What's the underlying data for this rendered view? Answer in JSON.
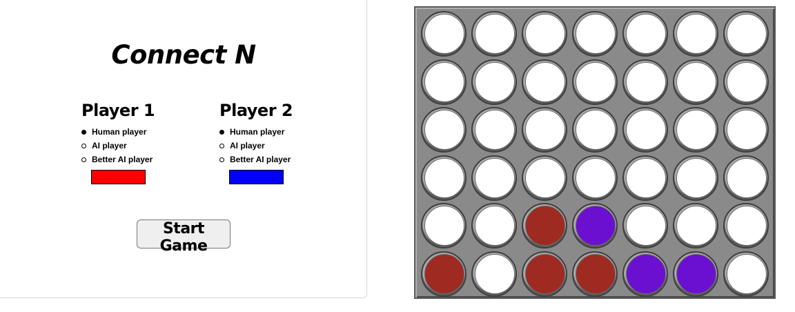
{
  "settings_panel": {
    "title": "Connect N",
    "start_button": "Start Game",
    "players": [
      {
        "heading": "Player 1",
        "options": [
          {
            "label": "Human player",
            "selected": true
          },
          {
            "label": "AI player",
            "selected": false
          },
          {
            "label": "Better AI player",
            "selected": false
          }
        ],
        "color": "#ff0000"
      },
      {
        "heading": "Player 2",
        "options": [
          {
            "label": "Human player",
            "selected": true
          },
          {
            "label": "AI player",
            "selected": false
          },
          {
            "label": "Better AI player",
            "selected": false
          }
        ],
        "color": "#0000ff"
      }
    ]
  },
  "board": {
    "columns": 7,
    "rows": 6,
    "disc_colors": {
      "empty": "#ffffff",
      "p1": "#9e2a22",
      "p2": "#6b10d1"
    },
    "cells": [
      [
        "empty",
        "empty",
        "empty",
        "empty",
        "empty",
        "empty",
        "empty"
      ],
      [
        "empty",
        "empty",
        "empty",
        "empty",
        "empty",
        "empty",
        "empty"
      ],
      [
        "empty",
        "empty",
        "empty",
        "empty",
        "empty",
        "empty",
        "empty"
      ],
      [
        "empty",
        "empty",
        "empty",
        "empty",
        "empty",
        "empty",
        "empty"
      ],
      [
        "empty",
        "empty",
        "p1",
        "p2",
        "empty",
        "empty",
        "empty"
      ],
      [
        "p1",
        "empty",
        "p1",
        "p1",
        "p2",
        "p2",
        "empty"
      ]
    ]
  }
}
